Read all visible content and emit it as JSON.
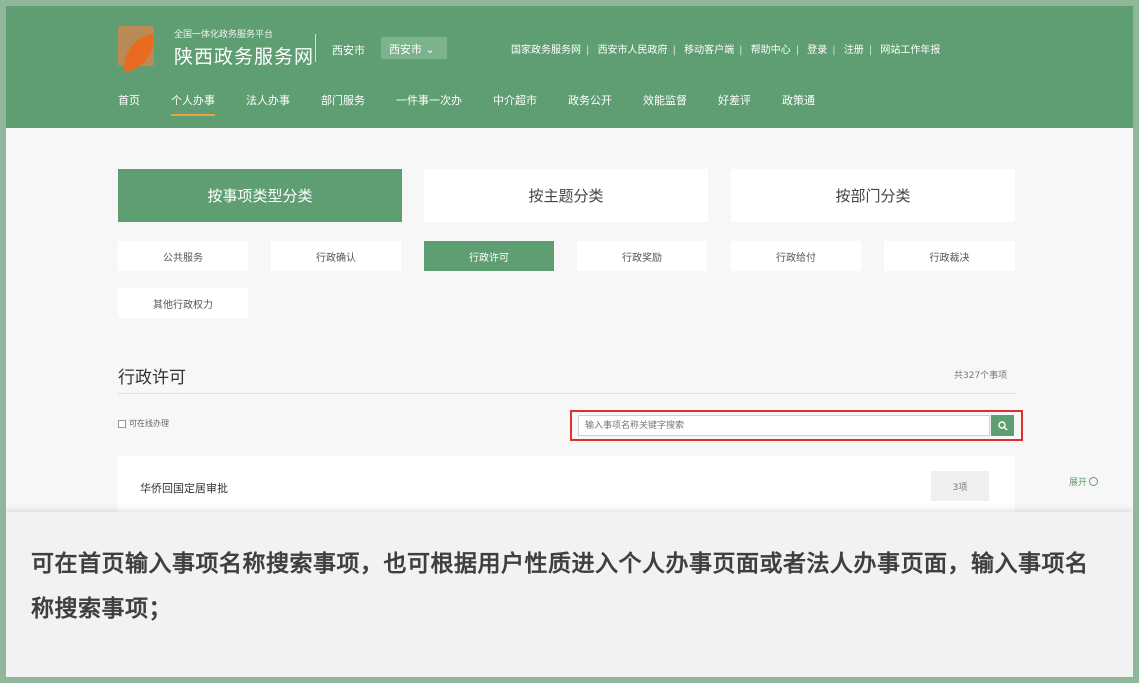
{
  "header": {
    "logo_sub": "全国一体化政务服务平台",
    "logo_title": "陕西政务服务网",
    "city_label": "西安市",
    "city_select": "西安市",
    "top_links": [
      "国家政务服务网",
      "西安市人民政府",
      "移动客户端",
      "帮助中心",
      "登录",
      "注册",
      "网站工作年报"
    ],
    "nav": [
      "首页",
      "个人办事",
      "法人办事",
      "部门服务",
      "一件事一次办",
      "中介超市",
      "政务公开",
      "效能监督",
      "好差评",
      "政策通"
    ],
    "nav_active_index": 1
  },
  "category_tabs": [
    "按事项类型分类",
    "按主题分类",
    "按部门分类"
  ],
  "sub_tabs": [
    "公共服务",
    "行政确认",
    "行政许可",
    "行政奖励",
    "行政给付",
    "行政裁决",
    "其他行政权力"
  ],
  "section": {
    "title": "行政许可",
    "count": "共327个事项"
  },
  "filter": {
    "online_label": "可在线办理"
  },
  "search": {
    "placeholder": "输入事项名称关键字搜索"
  },
  "item": {
    "name": "华侨回国定居审批",
    "badge": "3项",
    "expand": "展开"
  },
  "caption": "可在首页输入事项名称搜索事项，也可根据用户性质进入个人办事页面或者法人办事页面，输入事项名称搜索事项；",
  "colors": {
    "brand_green": "#5f9d72",
    "highlight_red": "#e0302a",
    "logo_orange": "#ea6a1f"
  }
}
